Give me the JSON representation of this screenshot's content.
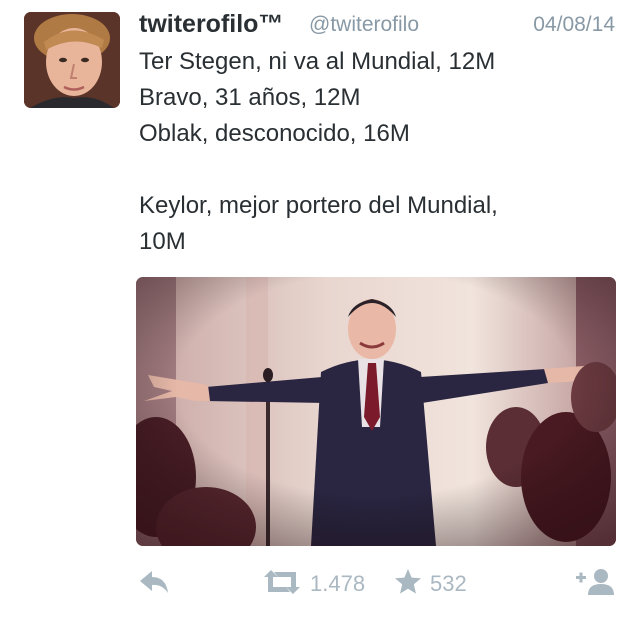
{
  "tweet": {
    "display_name": "twiterofilo™",
    "handle": "@twiterofilo",
    "date": "04/08/14",
    "lines": [
      "Ter Stegen, ni va al Mundial, 12M",
      "Bravo, 31 años, 12M",
      "Oblak, desconocido, 16M",
      "",
      "Keylor, mejor portero del Mundial,",
      "10M"
    ]
  },
  "actions": {
    "reply_icon": "reply-icon",
    "retweet_icon": "retweet-icon",
    "retweet_count": "1.478",
    "favorite_icon": "star-icon",
    "favorite_count": "532",
    "follow_icon": "follow-user-icon"
  },
  "colors": {
    "text": "#292f33",
    "muted": "#8899a6",
    "action": "#aab8c2"
  }
}
